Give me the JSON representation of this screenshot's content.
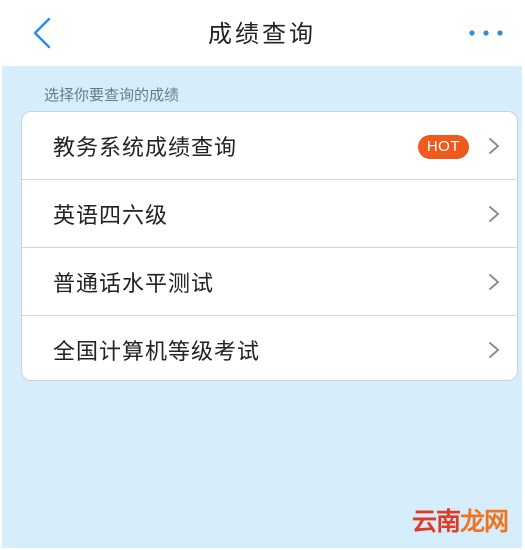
{
  "header": {
    "title": "成绩查询",
    "back_icon": "chevron-left-icon",
    "more_icon": "more-horizontal-icon",
    "accent_color": "#2f8be6"
  },
  "section": {
    "label": "选择你要查询的成绩"
  },
  "items": [
    {
      "label": "教务系统成绩查询",
      "badge": "HOT"
    },
    {
      "label": "英语四六级"
    },
    {
      "label": "普通话水平测试"
    },
    {
      "label": "全国计算机等级考试"
    }
  ],
  "colors": {
    "background": "#d6eefb",
    "badge": "#ee5b1c"
  },
  "watermark": {
    "part1": "云南",
    "part2": "龙网"
  }
}
